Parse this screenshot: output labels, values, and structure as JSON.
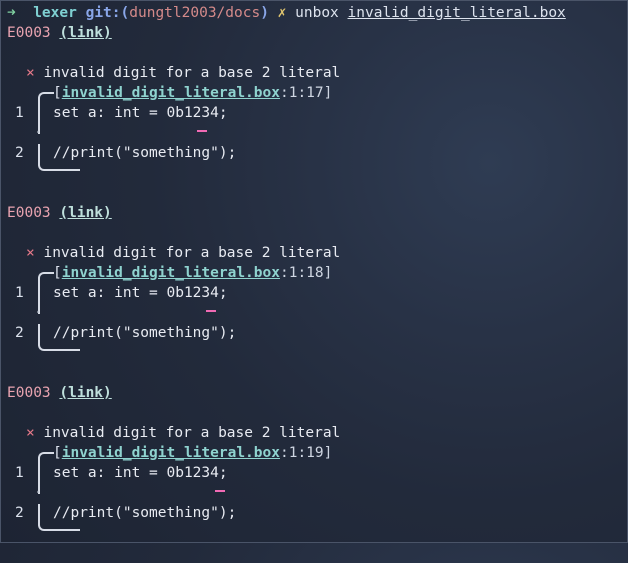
{
  "prompt": {
    "arrow": "➜",
    "directory": "lexer",
    "git_label": "git:",
    "paren_open": "(",
    "branch": "dungtl2003/docs",
    "paren_close": ")",
    "dirty_marker": "✗",
    "command": "unbox",
    "argument": "invalid_digit_literal.box"
  },
  "diagnostics": [
    {
      "code": "E0003",
      "link_label": "(link)",
      "cross": "×",
      "message": "invalid digit for a base 2 literal",
      "bracket_open": "[",
      "file": "invalid_digit_literal.box",
      "location": ":1:17]",
      "lines": [
        {
          "number": "1",
          "text": "set a: int = 0b1234;"
        },
        {
          "number": "2",
          "text": "//print(\"something\");"
        }
      ],
      "ellipsis": "·"
    },
    {
      "code": "E0003",
      "link_label": "(link)",
      "cross": "×",
      "message": "invalid digit for a base 2 literal",
      "bracket_open": "[",
      "file": "invalid_digit_literal.box",
      "location": ":1:18]",
      "lines": [
        {
          "number": "1",
          "text": "set a: int = 0b1234;"
        },
        {
          "number": "2",
          "text": "//print(\"something\");"
        }
      ],
      "ellipsis": "·"
    },
    {
      "code": "E0003",
      "link_label": "(link)",
      "cross": "×",
      "message": "invalid digit for a base 2 literal",
      "bracket_open": "[",
      "file": "invalid_digit_literal.box",
      "location": ":1:19]",
      "lines": [
        {
          "number": "1",
          "text": "set a: int = 0b1234;"
        },
        {
          "number": "2",
          "text": "//print(\"something\");"
        }
      ],
      "ellipsis": "·"
    }
  ]
}
